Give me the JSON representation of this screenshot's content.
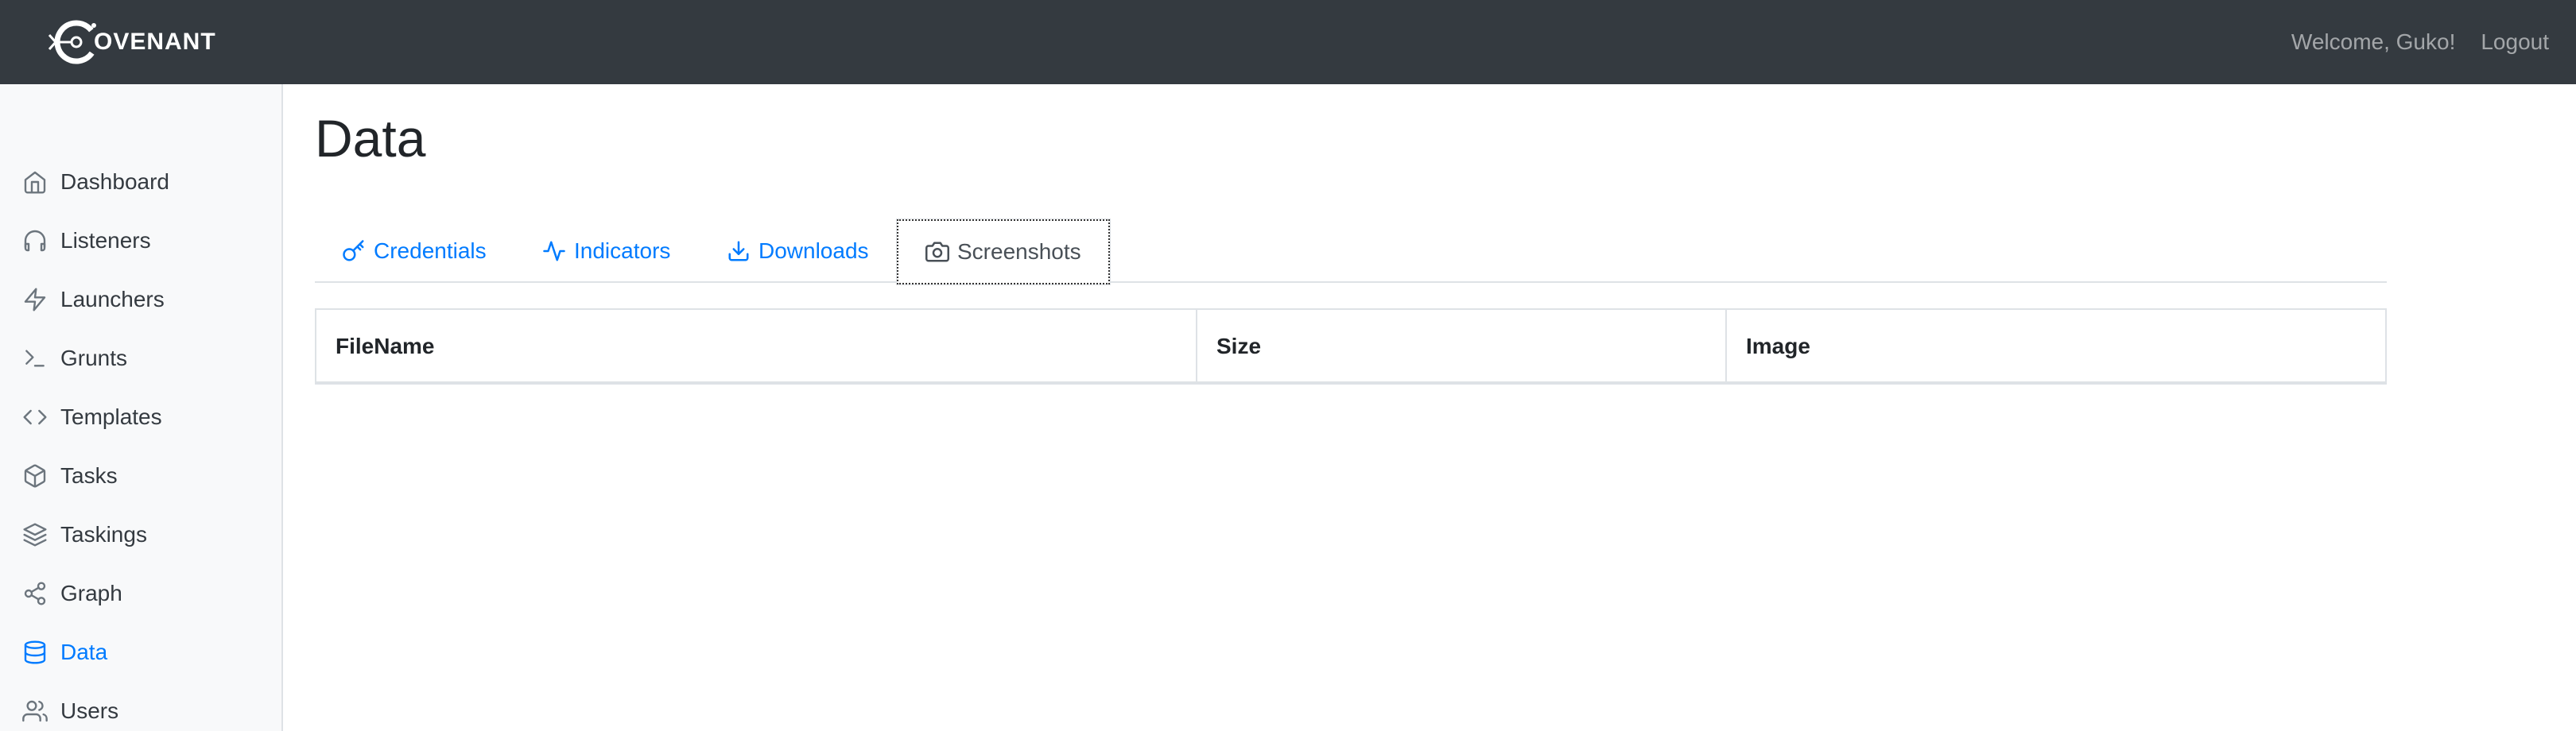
{
  "app": {
    "brand_text": "OVENANT",
    "logo_icon": "covenant-logo-icon"
  },
  "header": {
    "welcome": "Welcome, Guko!",
    "logout": "Logout"
  },
  "sidebar": {
    "items": [
      {
        "label": "Dashboard",
        "icon": "home-icon"
      },
      {
        "label": "Listeners",
        "icon": "headphones-icon"
      },
      {
        "label": "Launchers",
        "icon": "zap-icon"
      },
      {
        "label": "Grunts",
        "icon": "terminal-icon"
      },
      {
        "label": "Templates",
        "icon": "code-icon"
      },
      {
        "label": "Tasks",
        "icon": "box-icon"
      },
      {
        "label": "Taskings",
        "icon": "layers-icon"
      },
      {
        "label": "Graph",
        "icon": "share-icon"
      },
      {
        "label": "Data",
        "icon": "database-icon",
        "active": true
      },
      {
        "label": "Users",
        "icon": "users-icon"
      }
    ]
  },
  "main": {
    "title": "Data",
    "tabs": [
      {
        "label": "Credentials",
        "icon": "key-icon"
      },
      {
        "label": "Indicators",
        "icon": "activity-icon"
      },
      {
        "label": "Downloads",
        "icon": "download-icon"
      },
      {
        "label": "Screenshots",
        "icon": "camera-icon",
        "active": true
      }
    ],
    "table": {
      "columns": [
        "FileName",
        "Size",
        "Image"
      ],
      "rows": []
    }
  },
  "colors": {
    "navbar": "#343a40",
    "accent": "#007bff",
    "sidebar_bg": "#f8f9fa"
  }
}
